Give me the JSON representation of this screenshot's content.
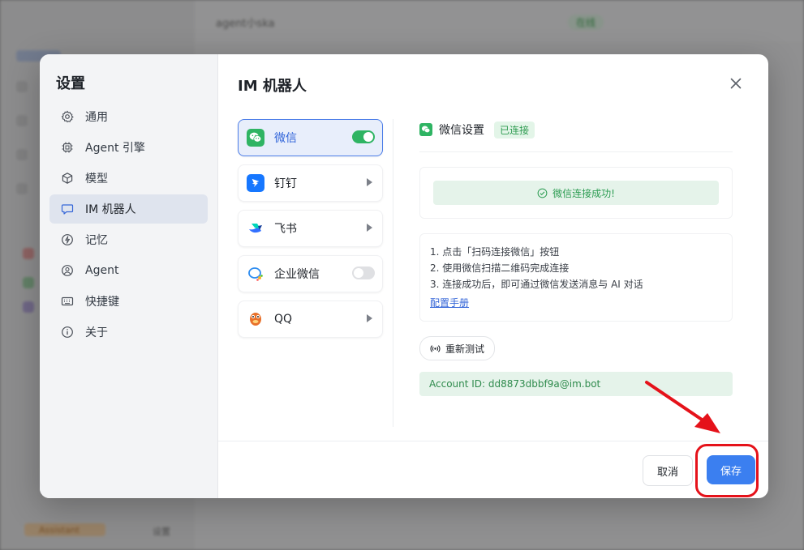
{
  "background": {
    "top_title": "agent小ska",
    "status": "在线",
    "bottom_label": "Assistant",
    "bottom_right": "设置"
  },
  "settings": {
    "title": "设置",
    "nav": [
      {
        "label": "通用",
        "icon": "gear-icon"
      },
      {
        "label": "Agent 引擎",
        "icon": "chip-icon"
      },
      {
        "label": "模型",
        "icon": "cube-icon"
      },
      {
        "label": "IM 机器人",
        "icon": "chat-bubble-icon",
        "active": true
      },
      {
        "label": "记忆",
        "icon": "lightning-icon"
      },
      {
        "label": "Agent",
        "icon": "user-circle-icon"
      },
      {
        "label": "快捷键",
        "icon": "keyboard-icon"
      },
      {
        "label": "关于",
        "icon": "info-icon"
      }
    ]
  },
  "im": {
    "title": "IM 机器人",
    "platforms": [
      {
        "label": "微信",
        "type": "toggle",
        "on": true,
        "active": true
      },
      {
        "label": "钉钉",
        "type": "arrow"
      },
      {
        "label": "飞书",
        "type": "arrow"
      },
      {
        "label": "企业微信",
        "type": "toggle",
        "on": false
      },
      {
        "label": "QQ",
        "type": "arrow"
      }
    ],
    "detail": {
      "title": "微信设置",
      "status_badge": "已连接",
      "success_message": "微信连接成功!",
      "steps": [
        "1. 点击「扫码连接微信」按钮",
        "2. 使用微信扫描二维码完成连接",
        "3. 连接成功后，即可通过微信发送消息与 AI 对话"
      ],
      "manual_link": "配置手册",
      "retest_label": "重新测试",
      "account_id": "Account ID: dd8873dbbf9a@im.bot"
    }
  },
  "footer": {
    "cancel_label": "取消",
    "save_label": "保存"
  },
  "colors": {
    "accent": "#3b7ff0",
    "success": "#2fb463",
    "annotation": "#e5121a"
  }
}
